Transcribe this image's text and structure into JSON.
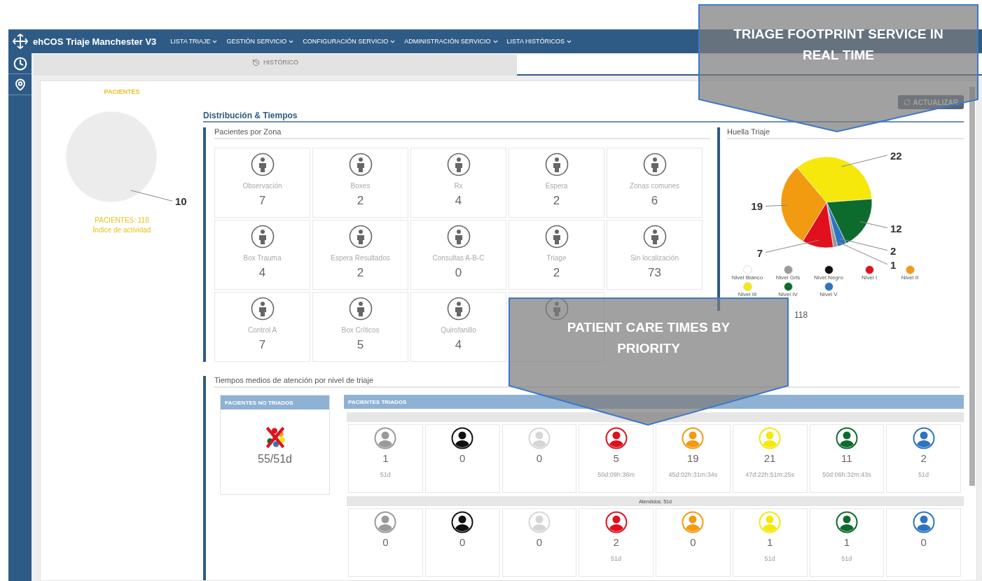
{
  "app": {
    "title": "ehCOS Triaje Manchester V3"
  },
  "menu": [
    {
      "label": "LISTA TRIAJE"
    },
    {
      "label": "GESTIÓN SERVICIO"
    },
    {
      "label": "CONFIGURACIÓN SERVICIO"
    },
    {
      "label": "ADMINISTRACIÓN SERVICIO"
    },
    {
      "label": "LISTA HISTÓRICOS"
    }
  ],
  "tabs": [
    {
      "label": "HISTÓRICO",
      "selected": true
    }
  ],
  "patients_panel": {
    "title": "PACIENTES",
    "chart_data": {
      "type": "pie",
      "values": [
        10
      ],
      "data_labels": true
    },
    "total": "PACIENTES: 118",
    "subtitle": "Índice de actividad"
  },
  "refresh_button": {
    "label": "ACTUALIZAR"
  },
  "section_title": "Distribución & Tiempos",
  "zones": {
    "title": "Pacientes por Zona",
    "items": [
      {
        "kind": "zone",
        "name": "Observación",
        "count": "7"
      },
      {
        "kind": "zone",
        "name": "Boxes",
        "count": "2"
      },
      {
        "kind": "zone",
        "name": "Rx",
        "count": "4"
      },
      {
        "kind": "zone",
        "name": "Espera",
        "count": "2"
      },
      {
        "kind": "zone",
        "name": "Zonas comunes",
        "count": "6"
      },
      {
        "kind": "zone",
        "name": "Box Trauma",
        "count": "4"
      },
      {
        "kind": "zone",
        "name": "Espera Resultados",
        "count": "2"
      },
      {
        "kind": "zone",
        "name": "Consultas A-B-C",
        "count": "0"
      },
      {
        "kind": "zone",
        "name": "Triage",
        "count": "2"
      },
      {
        "kind": "zone",
        "name": "Sin localización",
        "count": "73"
      },
      {
        "kind": "zone",
        "name": "Control A",
        "count": "7"
      },
      {
        "kind": "zone",
        "name": "Box Críticos",
        "count": "5"
      },
      {
        "kind": "zone",
        "name": "Quirofanillo",
        "count": "4"
      },
      {
        "kind": "covered"
      }
    ]
  },
  "footprint": {
    "title": "Huella Triaje",
    "chart_data": {
      "type": "pie",
      "categories": [
        "Nivel Blanco",
        "Nivel Gris",
        "Nivel Negro",
        "Nivel I",
        "Nivel II",
        "Nivel III",
        "Nivel IV",
        "Nivel V"
      ],
      "values": [
        0,
        1,
        0,
        7,
        19,
        22,
        12,
        2
      ],
      "data_labels": true
    },
    "legend": [
      {
        "color": "#ffffff"
      },
      {
        "color": "#9a9a9a"
      },
      {
        "color": "#111111"
      },
      {
        "color": "#e0101e"
      },
      {
        "color": "#f29a10"
      },
      {
        "color": "#f5e80a"
      },
      {
        "color": "#0e6b2e"
      },
      {
        "color": "#2d74c0"
      }
    ],
    "total": "118"
  },
  "care_times": {
    "title": "Tiempos medios de atención por nivel de triaje",
    "untriaged": {
      "header": "PACIENTES NO TRIADOS",
      "value": "55/51d"
    },
    "triaged": {
      "header": "PACIENTES TRIADOS",
      "groups": [
        {
          "items": [
            {
              "color": "#9a9a9a",
              "count": "1",
              "time": "51d"
            },
            {
              "color": "#111111",
              "count": "0"
            },
            {
              "color": "#d6d6d6",
              "count": "0"
            },
            {
              "color": "#e0101e",
              "count": "5",
              "time": "50d:09h:36m"
            },
            {
              "color": "#f29a10",
              "count": "19",
              "time": "45d:02h:31m:34s"
            },
            {
              "color": "#f5e80a",
              "count": "21",
              "time": "47d:22h:51m:25s"
            },
            {
              "color": "#0e6b2e",
              "count": "11",
              "time": "50d:06h:32m:43s"
            },
            {
              "color": "#2d74c0",
              "count": "2",
              "time": "51d"
            }
          ]
        },
        {
          "label": "Atendidos: 51d",
          "items": [
            {
              "color": "#9a9a9a",
              "count": "0"
            },
            {
              "color": "#111111",
              "count": "0"
            },
            {
              "color": "#d6d6d6",
              "count": "0"
            },
            {
              "color": "#e0101e",
              "count": "2",
              "time": "51d"
            },
            {
              "color": "#f29a10",
              "count": "0"
            },
            {
              "color": "#f5e80a",
              "count": "1",
              "time": "51d"
            },
            {
              "color": "#0e6b2e",
              "count": "1",
              "time": "51d"
            },
            {
              "color": "#2d74c0",
              "count": "0"
            }
          ]
        }
      ]
    }
  },
  "callouts": [
    {
      "text": "TRIAGE FOOTPRINT SERVICE IN REAL TIME"
    },
    {
      "text": "PATIENT CARE TIMES BY PRIORITY"
    }
  ]
}
